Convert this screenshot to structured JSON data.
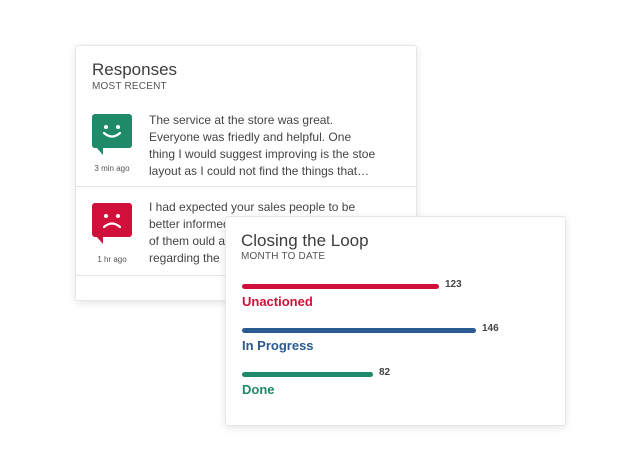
{
  "responses": {
    "title": "Responses",
    "subtitle": "MOST RECENT",
    "items": [
      {
        "sentiment": "positive",
        "icon": "happy-face-icon",
        "color": "#1e8a6a",
        "time": "3 min ago",
        "text": "The service at the store was great.\nEveryone was friedly and helpful. One\nthing I would suggest improving is the stoe\nlayout as I could not find the things that…"
      },
      {
        "sentiment": "negative",
        "icon": "sad-face-icon",
        "color": "#d0103a",
        "time": "1 hr ago",
        "text": "I had expected your sales people to be\nbetter informed\nof them ould a\nregarding the"
      }
    ]
  },
  "closing_loop": {
    "title": "Closing the Loop",
    "subtitle": "MONTH TO DATE",
    "bars": [
      {
        "label": "Unactioned",
        "value": 123,
        "display": "123",
        "color": "#d0103a"
      },
      {
        "label": "In Progress",
        "value": 146,
        "display": "146",
        "color": "#2a5a8f"
      },
      {
        "label": "Done",
        "value": 82,
        "display": "82",
        "color": "#1e8a6a"
      }
    ]
  }
}
